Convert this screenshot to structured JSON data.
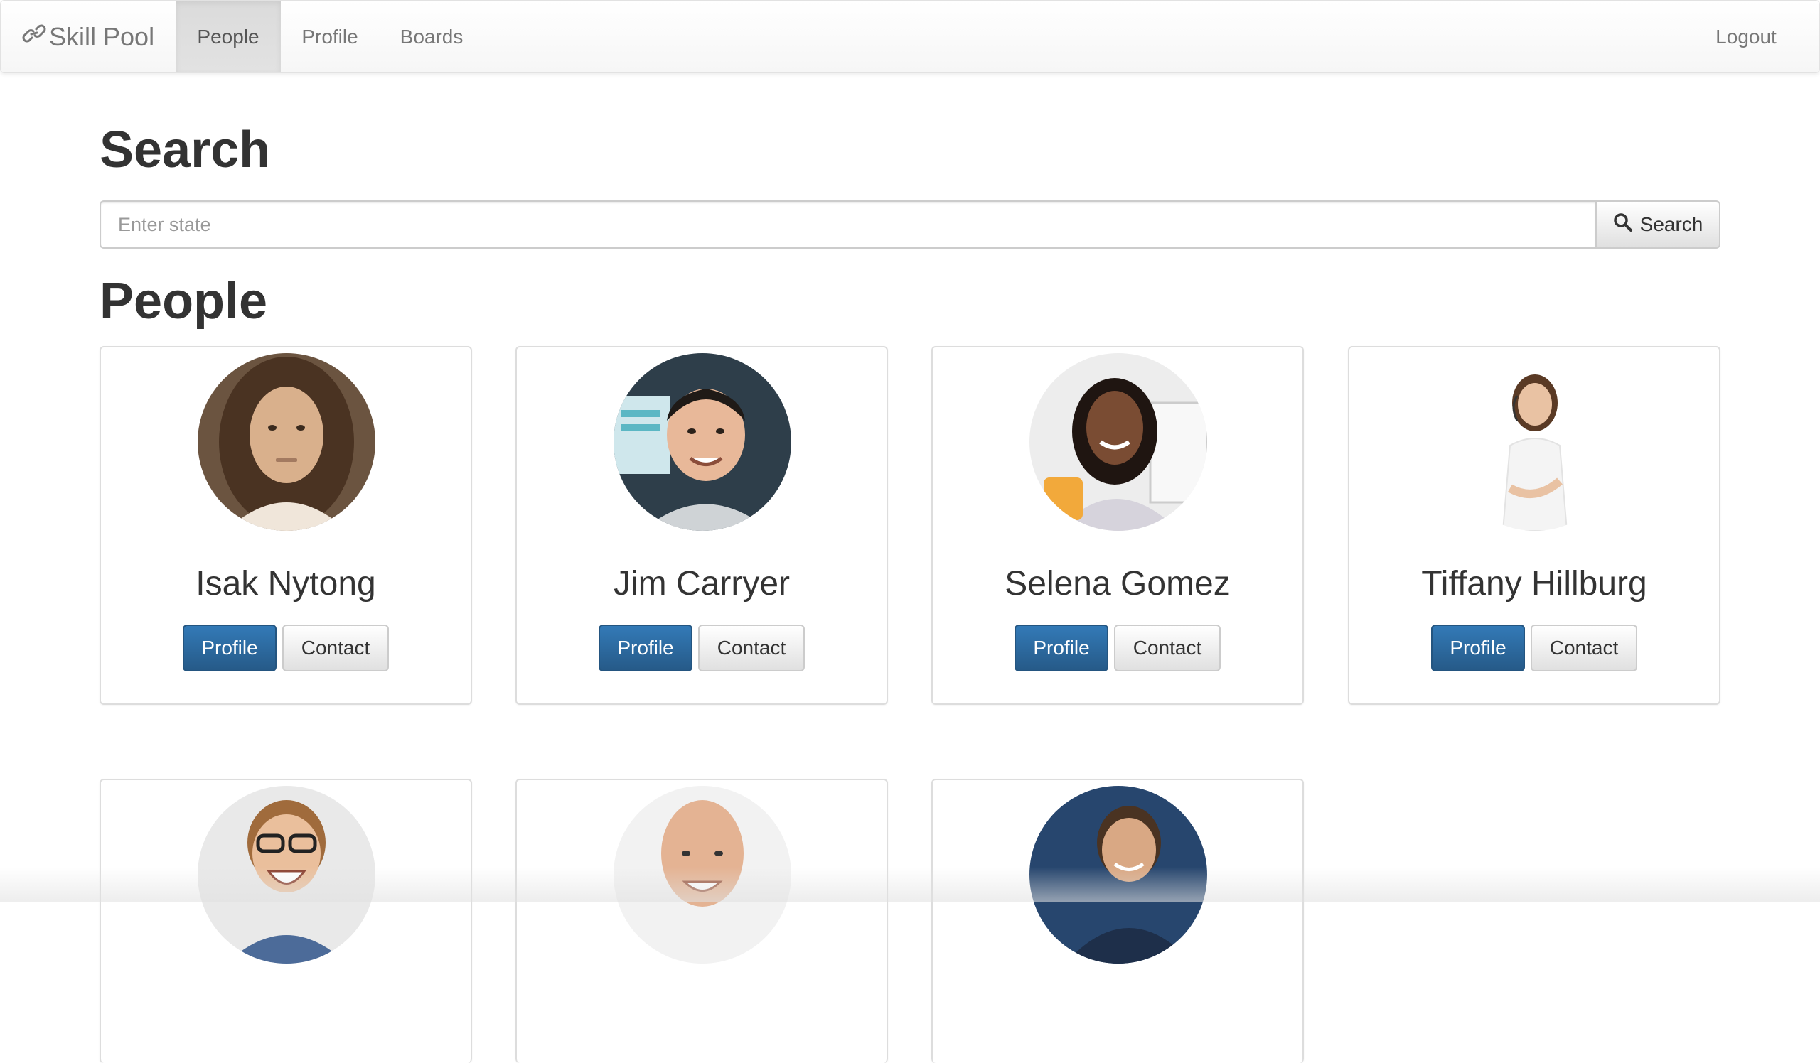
{
  "navbar": {
    "brand": "Skill Pool",
    "items": [
      {
        "label": "People",
        "active": true
      },
      {
        "label": "Profile",
        "active": false
      },
      {
        "label": "Boards",
        "active": false
      }
    ],
    "logout": "Logout"
  },
  "search": {
    "heading": "Search",
    "placeholder": "Enter state",
    "button_label": "Search"
  },
  "people": {
    "heading": "People",
    "cards": [
      {
        "name": "Isak Nytong",
        "profile_label": "Profile",
        "contact_label": "Contact"
      },
      {
        "name": "Jim Carryer",
        "profile_label": "Profile",
        "contact_label": "Contact"
      },
      {
        "name": "Selena Gomez",
        "profile_label": "Profile",
        "contact_label": "Contact"
      },
      {
        "name": "Tiffany Hillburg",
        "profile_label": "Profile",
        "contact_label": "Contact"
      },
      {
        "name": "",
        "profile_label": "",
        "contact_label": ""
      },
      {
        "name": "",
        "profile_label": "",
        "contact_label": ""
      },
      {
        "name": "",
        "profile_label": "",
        "contact_label": ""
      }
    ]
  },
  "colors": {
    "primary": "#337ab7",
    "primary_dark": "#265a88",
    "navbar_text": "#777777",
    "heading_text": "#333333"
  }
}
